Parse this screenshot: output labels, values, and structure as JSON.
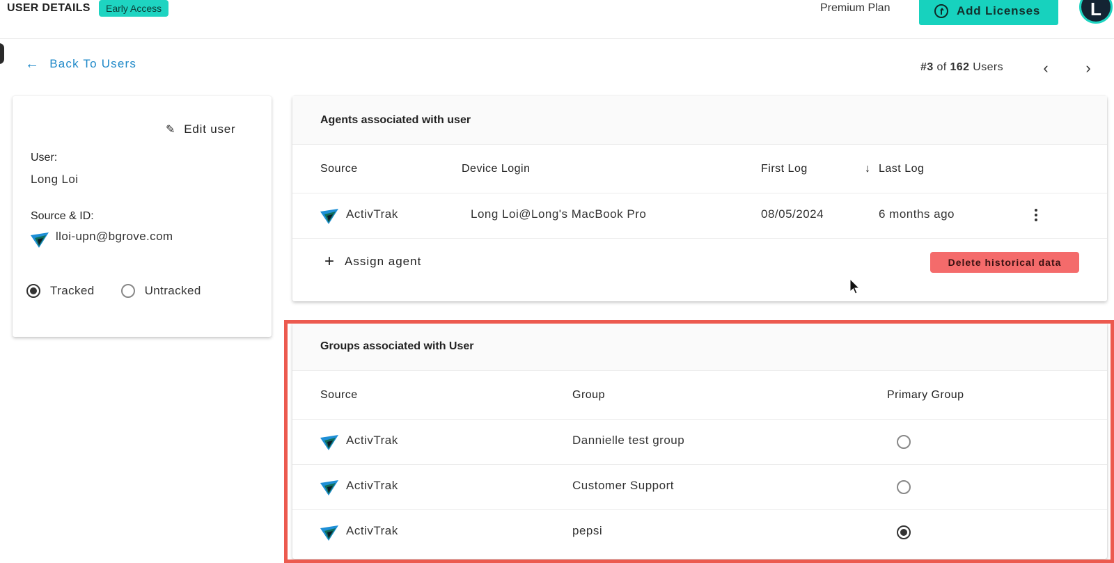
{
  "header": {
    "title": "USER DETAILS",
    "badge": "Early Access",
    "plan": "Premium Plan",
    "add_licenses": "Add Licenses",
    "avatar_letter": "L"
  },
  "nav": {
    "back": "Back To Users",
    "pager": {
      "prefix": "#",
      "current": "3",
      "of": "of",
      "total": "162",
      "suffix": "Users"
    }
  },
  "user_card": {
    "edit_label": "Edit user",
    "user_label": "User:",
    "user_value": "Long Loi",
    "source_label": "Source & ID:",
    "source_value": "lloi-upn@bgrove.com",
    "tracking": {
      "tracked": "Tracked",
      "untracked": "Untracked",
      "selected": "Tracked"
    }
  },
  "agents": {
    "title": "Agents associated with user",
    "columns": [
      "Source",
      "Device Login",
      "First Log",
      "Last Log"
    ],
    "sort_indicator": "↓",
    "rows": [
      {
        "source": "ActivTrak",
        "device_login": "Long Loi@Long's MacBook Pro",
        "first_log": "08/05/2024",
        "last_log": "6 months ago"
      }
    ],
    "assign_label": "Assign agent",
    "delete_label": "Delete historical data"
  },
  "groups": {
    "title": "Groups associated with User",
    "columns": [
      "Source",
      "Group",
      "Primary Group"
    ],
    "rows": [
      {
        "source": "ActivTrak",
        "group": "Dannielle test group",
        "primary": false
      },
      {
        "source": "ActivTrak",
        "group": "Customer Support",
        "primary": false
      },
      {
        "source": "ActivTrak",
        "group": "pepsi",
        "primary": true
      }
    ]
  },
  "colors": {
    "accent_teal": "#17d2be",
    "link_blue": "#1e88c8",
    "danger": "#f46b6b",
    "highlight_border": "#ec5a4f"
  }
}
